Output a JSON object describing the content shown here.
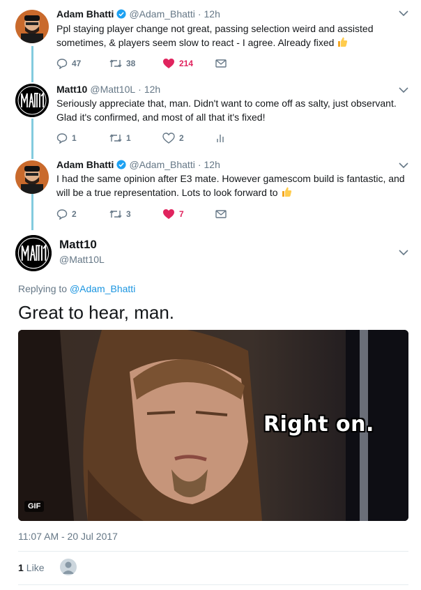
{
  "thread": [
    {
      "name": "Adam Bhatti",
      "handle": "@Adam_Bhatti",
      "separator": "·",
      "time": "12h",
      "verified": true,
      "text": "Ppl staying player change not great, passing selection weird and assisted sometimes, & players seem slow to react - I agree. Already fixed",
      "emoji": "thumbs-up-icon",
      "replies": "47",
      "retweets": "38",
      "likes": "214",
      "liked": true
    },
    {
      "name": "Matt10",
      "handle": "@Matt10L",
      "separator": "·",
      "time": "12h",
      "verified": false,
      "text": "Seriously appreciate that, man. Didn't want to come off as salty, just observant. Glad it's confirmed, and most of all that it's fixed!",
      "replies": "1",
      "retweets": "1",
      "likes": "2",
      "liked": false
    },
    {
      "name": "Adam Bhatti",
      "handle": "@Adam_Bhatti",
      "separator": "·",
      "time": "12h",
      "verified": true,
      "text": "I had the same opinion after E3 mate. However gamescom build is fantastic, and will be a true representation. Lots to look forward to",
      "emoji": "thumbs-up-icon",
      "replies": "2",
      "retweets": "3",
      "likes": "7",
      "liked": true
    }
  ],
  "main": {
    "name": "Matt10",
    "handle": "@Matt10L",
    "replying_prefix": "Replying to",
    "replying_to": "@Adam_Bhatti",
    "text": "Great to hear, man.",
    "gif_caption": "Right on.",
    "gif_badge": "GIF",
    "timestamp": "11:07 AM - 20 Jul 2017",
    "like_count": "1",
    "like_label": "Like"
  },
  "colors": {
    "accent": "#1da1f2",
    "like": "#e0245e",
    "muted": "#657786",
    "thread_line": "#1da1c2"
  }
}
